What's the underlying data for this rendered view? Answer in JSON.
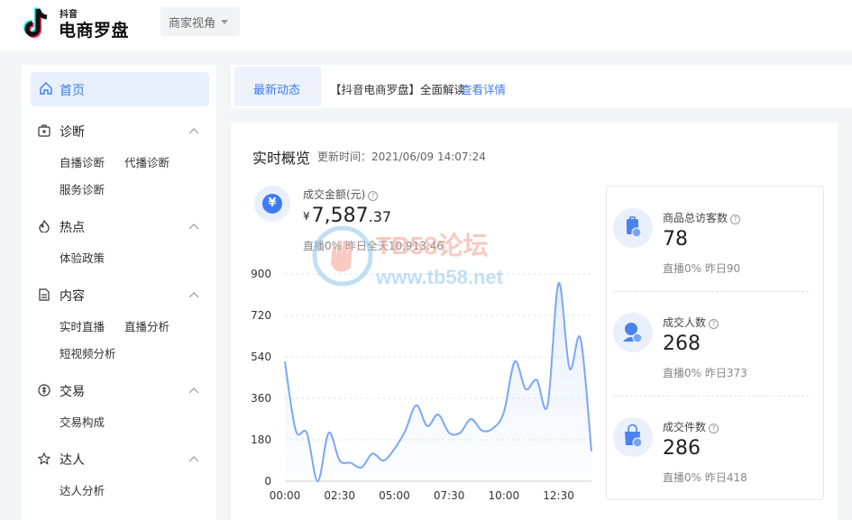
{
  "header": {
    "brand_top": "抖音",
    "brand_main": "电商罗盘",
    "view_select": "商家视角"
  },
  "sidebar": {
    "home": "首页",
    "sections": [
      {
        "label": "诊断",
        "icon": "diagnosis-icon",
        "items": [
          "自播诊断",
          "代播诊断",
          "服务诊断"
        ]
      },
      {
        "label": "热点",
        "icon": "flame-icon",
        "items": [
          "体验政策"
        ]
      },
      {
        "label": "内容",
        "icon": "document-icon",
        "items": [
          "实时直播",
          "直播分析",
          "短视频分析"
        ]
      },
      {
        "label": "交易",
        "icon": "trade-icon",
        "items": [
          "交易构成"
        ]
      },
      {
        "label": "达人",
        "icon": "star-icon",
        "items": [
          "达人分析"
        ]
      }
    ]
  },
  "news": {
    "tab": "最新动态",
    "text": "【抖音电商罗盘】全面解读",
    "link": "查看详情"
  },
  "overview": {
    "title": "实时概览",
    "updated": "更新时间：2021/06/09 14:07:24",
    "gmv": {
      "label": "成交金额(元)",
      "currency": "¥",
      "int": "7,587",
      "dec": ".37",
      "sub": "直播0%   昨日全天10,913.46"
    }
  },
  "stats": [
    {
      "label": "商品总访客数",
      "value": "78",
      "sub": "直播0%   昨日90",
      "icon": "product-visitors-icon"
    },
    {
      "label": "成交人数",
      "value": "268",
      "sub": "直播0%   昨日373",
      "icon": "buyers-icon"
    },
    {
      "label": "成交件数",
      "value": "286",
      "sub": "直播0%   昨日418",
      "icon": "items-sold-icon"
    }
  ],
  "watermark": {
    "line1": "TB58论坛",
    "line2": "www.tb58.net"
  },
  "colors": {
    "accent": "#3d7bf7",
    "line": "#7ba7f5"
  },
  "chart_data": {
    "type": "line",
    "y_ticks": [
      "900",
      "720",
      "540",
      "360",
      "180",
      "0"
    ],
    "x_ticks": [
      "00:00",
      "02:30",
      "05:00",
      "07:30",
      "10:00",
      "12:30"
    ],
    "ylim": [
      0,
      900
    ],
    "x": [
      "00:00",
      "00:30",
      "01:00",
      "01:30",
      "02:00",
      "02:30",
      "03:00",
      "03:30",
      "04:00",
      "04:30",
      "05:00",
      "05:30",
      "06:00",
      "06:30",
      "07:00",
      "07:30",
      "08:00",
      "08:30",
      "09:00",
      "09:30",
      "10:00",
      "10:30",
      "11:00",
      "11:30",
      "12:00",
      "12:30",
      "13:00",
      "13:30",
      "14:00"
    ],
    "series": [
      {
        "values": [
          520,
          220,
          210,
          0,
          210,
          90,
          80,
          60,
          120,
          90,
          140,
          220,
          330,
          240,
          290,
          210,
          210,
          270,
          220,
          230,
          300,
          520,
          400,
          440,
          330,
          860,
          490,
          620,
          130
        ]
      }
    ]
  }
}
